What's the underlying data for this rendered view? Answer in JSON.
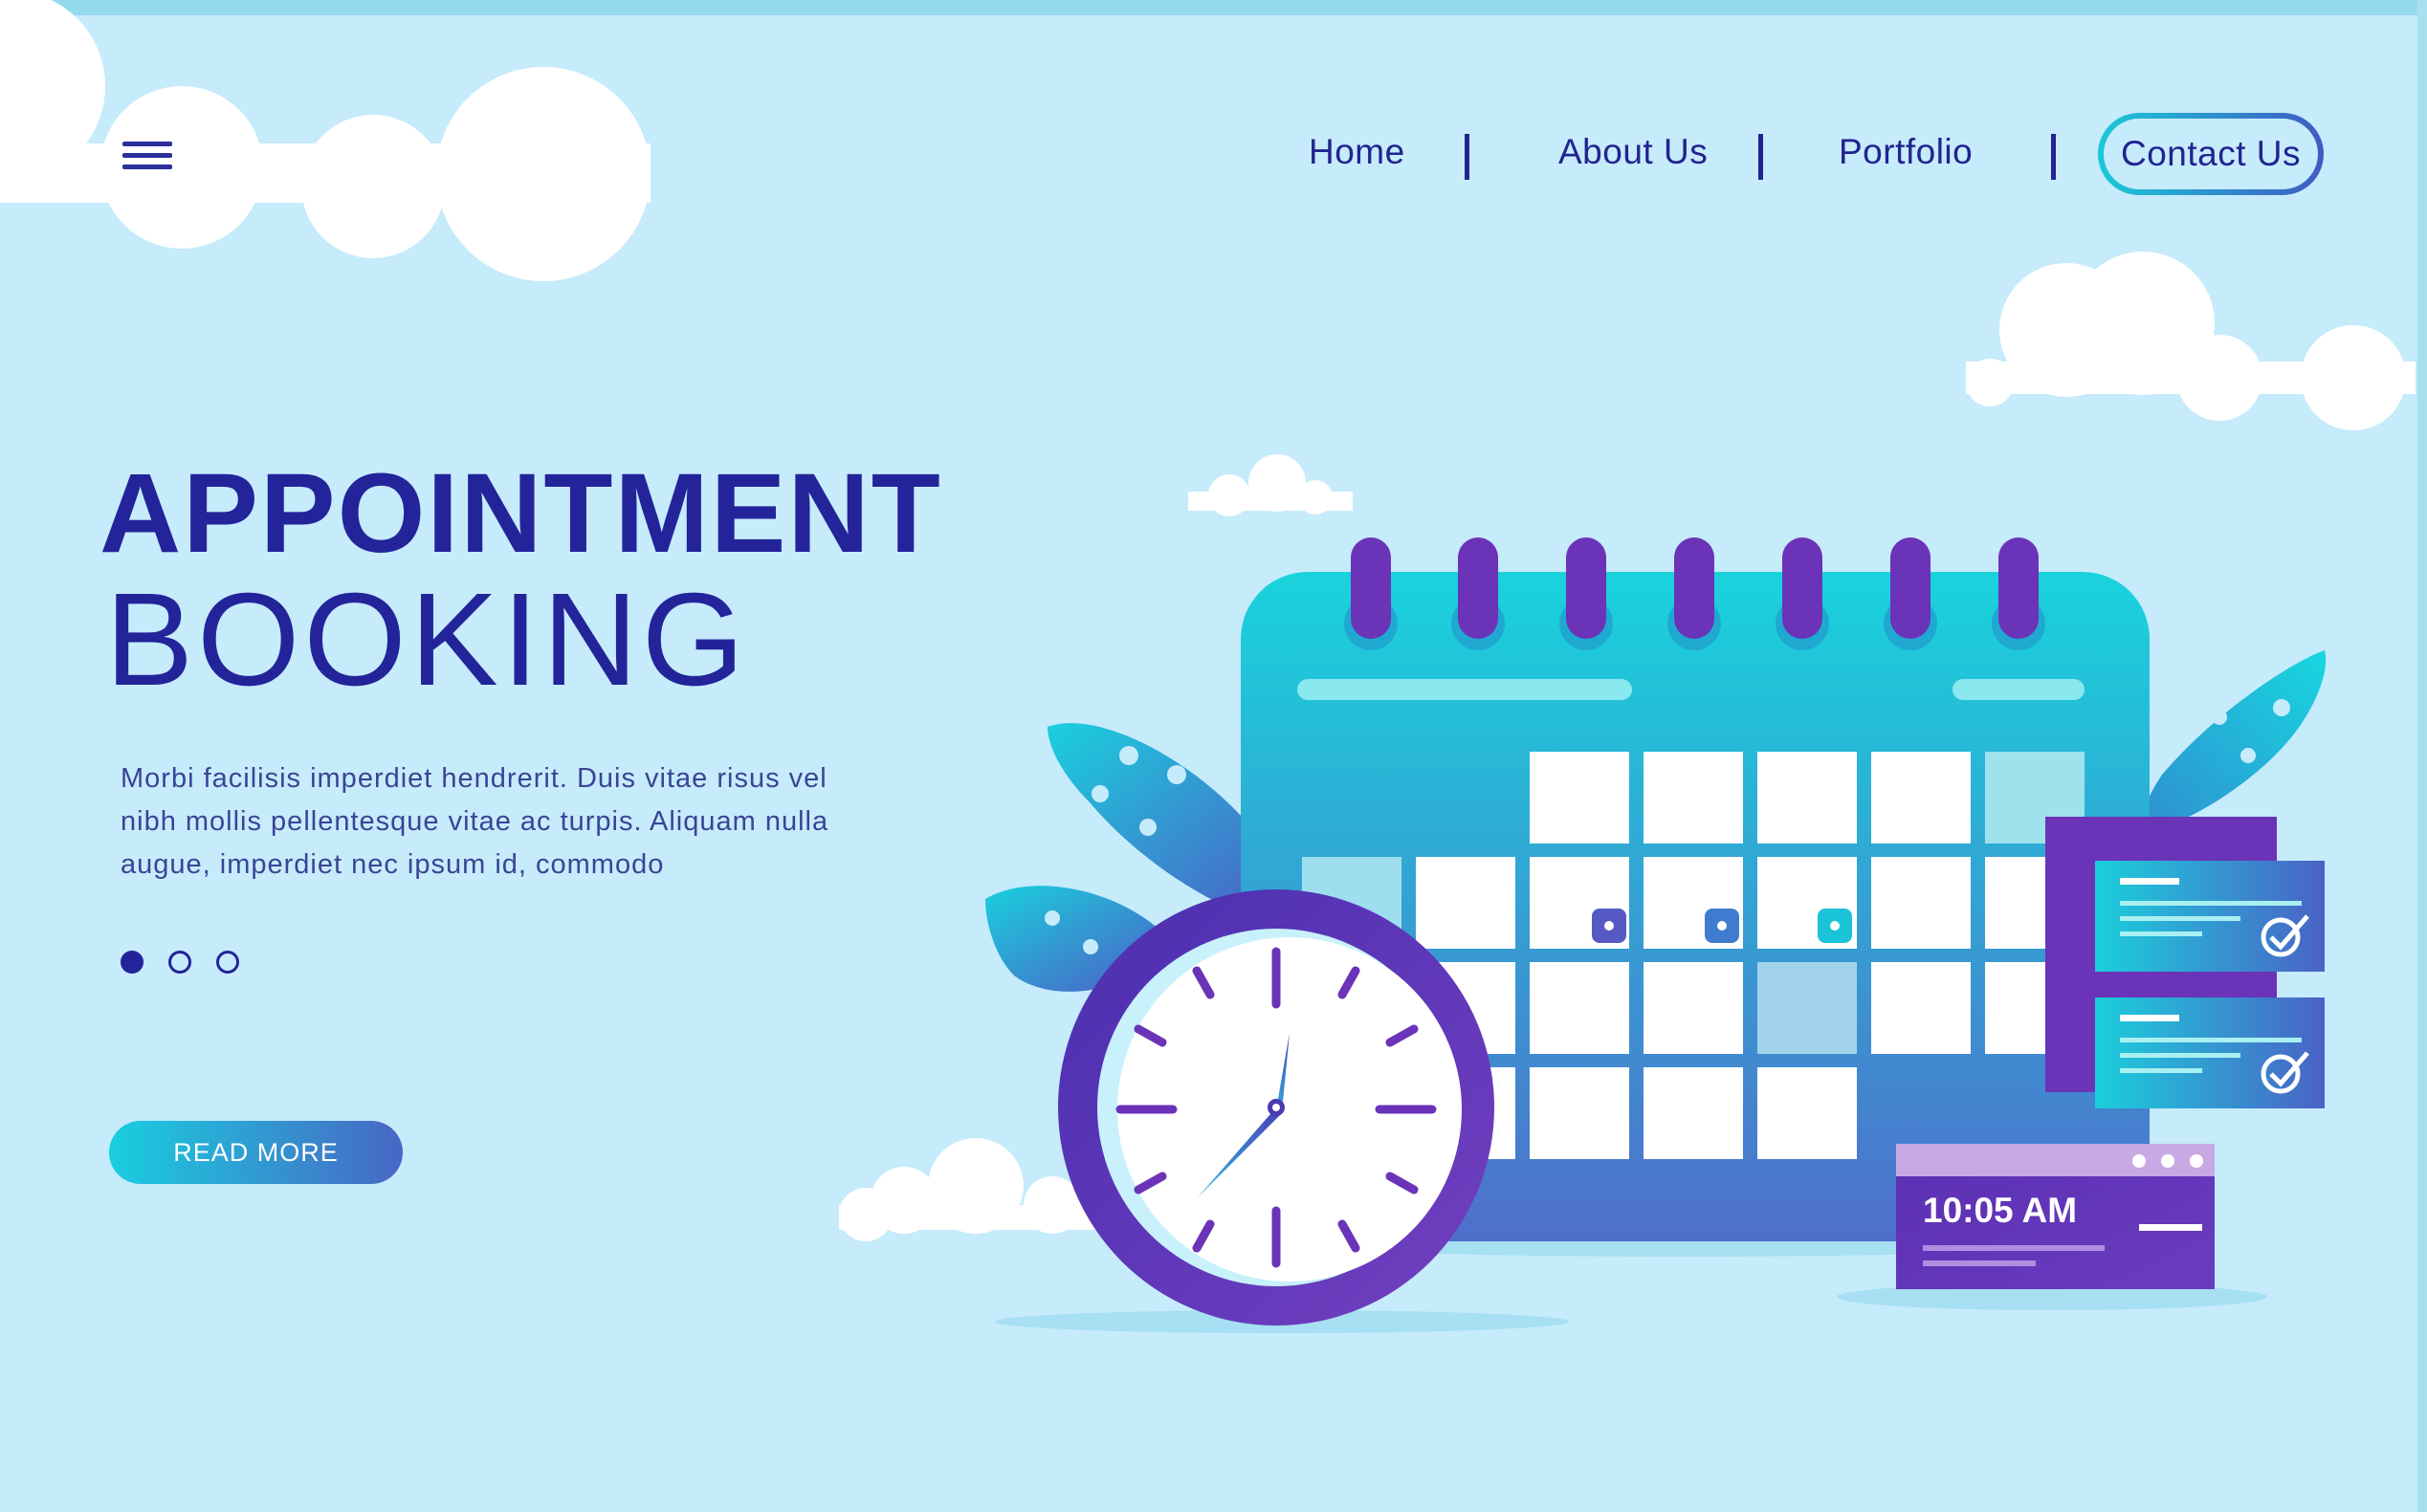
{
  "nav": {
    "menu_icon": "hamburger-menu-icon",
    "links": [
      "Home",
      "About Us",
      "Portfolio"
    ],
    "contact": "Contact Us"
  },
  "hero": {
    "title_line1": "APPOINTMENT",
    "title_line2": "BOOKING",
    "description": "Morbi facilisis imperdiet hendrerit. Duis vitae risus vel nibh mollis pellentesque vitae ac turpis. Aliquam nulla augue, imperdiet nec ipsum id, commodo",
    "read_more": "READ MORE",
    "slides": 3,
    "active_slide": 1
  },
  "illustration": {
    "time_display": "10:05 AM",
    "icons": [
      "calendar-icon",
      "clock-icon",
      "checklist-icon",
      "time-widget-icon",
      "leaf-icon",
      "cloud-icon"
    ]
  },
  "colors": {
    "background": "#c6ebfb",
    "primary_text": "#23249a",
    "accent_cyan": "#1bc9d9",
    "accent_purple": "#5a2fb0"
  }
}
